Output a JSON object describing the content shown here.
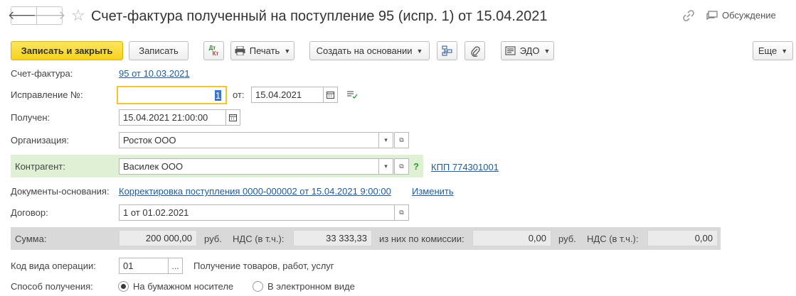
{
  "window": {
    "title": "Счет-фактура полученный на поступление 95 (испр. 1) от 15.04.2021",
    "discussion_label": "Обсуждение"
  },
  "toolbar": {
    "save_close_label": "Записать и закрыть",
    "save_label": "Записать",
    "dt_kt_top": "Дт",
    "dt_kt_bottom": "Кт",
    "print_label": "Печать",
    "create_based_label": "Создать на основании",
    "edo_label": "ЭДО",
    "more_label": "Еще"
  },
  "form": {
    "invoice": {
      "label": "Счет-фактура:",
      "value": "95 от 10.03.2021"
    },
    "correction": {
      "label": "Исправление №:",
      "value": "1",
      "date_label": "от:",
      "date_value": "15.04.2021"
    },
    "received": {
      "label": "Получен:",
      "value": "15.04.2021 21:00:00"
    },
    "organization": {
      "label": "Организация:",
      "value": "Росток ООО"
    },
    "counterparty": {
      "label": "Контрагент:",
      "value": "Василек ООО",
      "help": "?",
      "kpp_link": "КПП 774301001"
    },
    "base_docs": {
      "label": "Документы-основания:",
      "value": "Корректировка поступления 0000-000002 от 15.04.2021 9:00:00",
      "change_link": "Изменить"
    },
    "contract": {
      "label": "Договор:",
      "value": "1 от 01.02.2021"
    },
    "totals": {
      "sum_label": "Сумма:",
      "sum_value": "200 000,00",
      "currency1": "руб.",
      "vat_label1": "НДС (в т.ч.):",
      "vat_value1": "33 333,33",
      "commission_label": "из них по комиссии:",
      "commission_value": "0,00",
      "currency2": "руб.",
      "vat_label2": "НДС (в т.ч.):",
      "vat_value2": "0,00"
    },
    "operation_code": {
      "label": "Код вида операции:",
      "value": "01",
      "description": "Получение товаров, работ, услуг",
      "select_btn": "..."
    },
    "receive_method": {
      "label": "Способ получения:",
      "option_paper": "На бумажном носителе",
      "option_electronic": "В электронном виде",
      "selected": "paper"
    }
  },
  "colors": {
    "primary_button": "#f6d220",
    "link": "#1f5a9a",
    "counterparty_highlight": "#dff0d4",
    "totals_band": "#d9d9d9"
  }
}
